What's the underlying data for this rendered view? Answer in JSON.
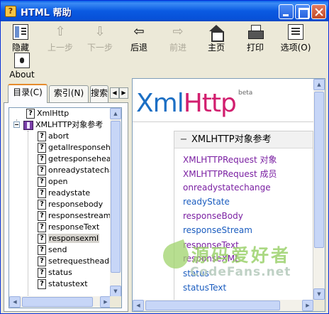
{
  "window": {
    "title": "HTML 帮助",
    "app_icon": "?"
  },
  "title_buttons": {
    "minimize": "minimize-icon",
    "maximize": "maximize-icon",
    "close": "close-icon"
  },
  "toolbar": {
    "hide": "隐藏",
    "back": "上一步",
    "forward": "下一步",
    "retreat": "后退",
    "advance": "前进",
    "home": "主页",
    "print": "打印",
    "options": "选项(O)",
    "about": "About"
  },
  "tabs": {
    "contents": "目录(C)",
    "index": "索引(N)",
    "search": "搜索"
  },
  "tree": {
    "root": "XmlHttp",
    "book": "XMLHTTP对象参考",
    "items": [
      "abort",
      "getallresponseheaders",
      "getresponseheader",
      "onreadystatechange",
      "open",
      "readystate",
      "responsebody",
      "responsestream",
      "responseText",
      "responsexml",
      "send",
      "setrequestheader",
      "status",
      "statustext"
    ],
    "selected_item": "responsexml"
  },
  "content": {
    "logo_part1": "Xml",
    "logo_part2": "Http",
    "beta": "beta",
    "ref_title": "XMLHTTP对象参考",
    "collapse": "−",
    "links": [
      "XMLHTTPRequest 对象",
      "XMLHTTPRequest 成员",
      "onreadystatechange",
      "readyState",
      "responseBody",
      "responseStream",
      "responseText",
      "responseXML",
      "status",
      "statusText"
    ]
  },
  "watermark": {
    "text": "源码爱好者",
    "sub": "CodeFans.net"
  },
  "colors": {
    "title_bar": "#0a5ae2",
    "logo_xml": "#1c6fc4",
    "logo_http": "#d21f6f",
    "link_visited": "#7a1fa2",
    "link": "#1a5cbf"
  }
}
